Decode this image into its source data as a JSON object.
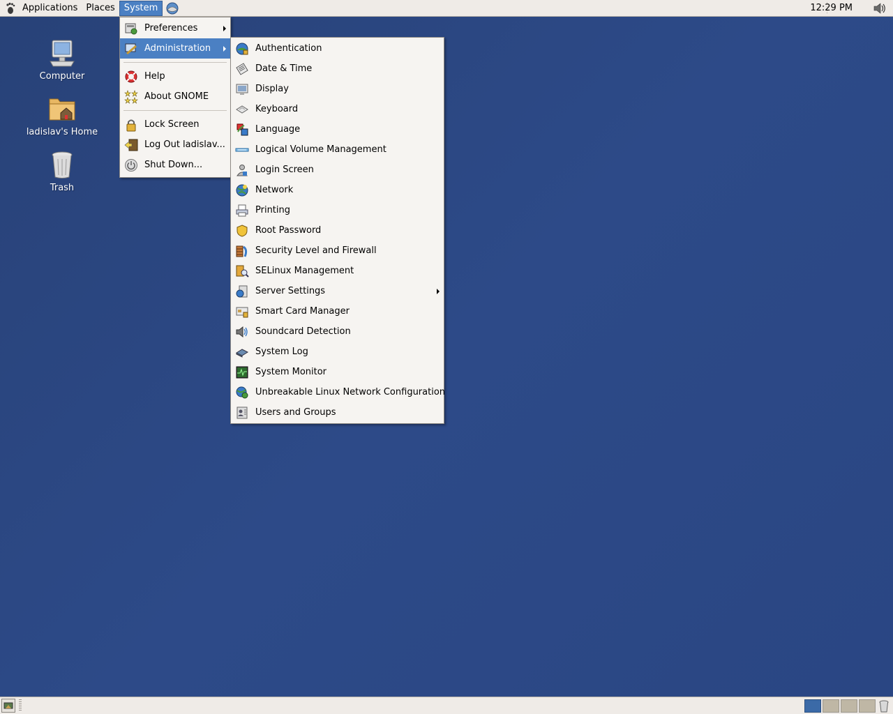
{
  "top_panel": {
    "menus": [
      "Applications",
      "Places",
      "System"
    ],
    "clock": "12:29 PM"
  },
  "desktop_icons": [
    {
      "label": "Computer",
      "icon": "computer-icon"
    },
    {
      "label": "ladislav's Home",
      "icon": "home-folder-icon"
    },
    {
      "label": "Trash",
      "icon": "trash-icon"
    }
  ],
  "system_menu": {
    "items": [
      {
        "label": "Preferences",
        "icon": "preferences-icon",
        "submenu": true
      },
      {
        "label": "Administration",
        "icon": "administration-icon",
        "submenu": true,
        "highlighted": true
      },
      {
        "label": "Help",
        "icon": "help-icon"
      },
      {
        "label": "About GNOME",
        "icon": "about-gnome-icon"
      },
      {
        "label": "Lock Screen",
        "icon": "lock-icon"
      },
      {
        "label": "Log Out ladislav...",
        "icon": "logout-icon"
      },
      {
        "label": "Shut Down...",
        "icon": "shutdown-icon"
      }
    ]
  },
  "admin_menu": {
    "items": [
      {
        "label": "Authentication",
        "icon": "authentication-icon"
      },
      {
        "label": "Date & Time",
        "icon": "date-time-icon"
      },
      {
        "label": "Display",
        "icon": "display-icon"
      },
      {
        "label": "Keyboard",
        "icon": "keyboard-icon"
      },
      {
        "label": "Language",
        "icon": "language-icon"
      },
      {
        "label": "Logical Volume Management",
        "icon": "lvm-icon"
      },
      {
        "label": "Login Screen",
        "icon": "login-screen-icon"
      },
      {
        "label": "Network",
        "icon": "network-icon"
      },
      {
        "label": "Printing",
        "icon": "printer-icon"
      },
      {
        "label": "Root Password",
        "icon": "root-password-icon"
      },
      {
        "label": "Security Level and Firewall",
        "icon": "firewall-icon"
      },
      {
        "label": "SELinux Management",
        "icon": "selinux-icon"
      },
      {
        "label": "Server Settings",
        "icon": "server-settings-icon",
        "submenu": true
      },
      {
        "label": "Smart Card Manager",
        "icon": "smart-card-icon"
      },
      {
        "label": "Soundcard Detection",
        "icon": "soundcard-icon"
      },
      {
        "label": "System Log",
        "icon": "system-log-icon"
      },
      {
        "label": "System Monitor",
        "icon": "system-monitor-icon"
      },
      {
        "label": "Unbreakable Linux Network Configuration",
        "icon": "uln-config-icon"
      },
      {
        "label": "Users and Groups",
        "icon": "users-groups-icon"
      }
    ]
  },
  "colors": {
    "desktop": "#2d4a88",
    "panel": "#efebe7",
    "highlight": "#4b80c3",
    "menu_bg": "#f6f4f1"
  },
  "workspaces": {
    "count": 4,
    "active": 1
  }
}
